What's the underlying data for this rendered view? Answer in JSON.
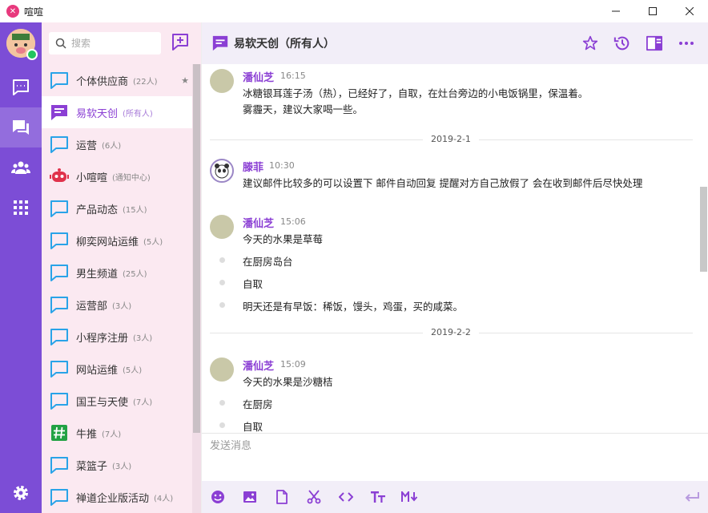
{
  "window": {
    "title": "喧喧",
    "minimize_icon": "minimize-icon",
    "maximize_icon": "maximize-icon",
    "close_icon": "close-icon"
  },
  "rail": {
    "user_status": "online",
    "items": [
      {
        "name": "chat-icon",
        "active": false
      },
      {
        "name": "discussion-icon",
        "active": true
      },
      {
        "name": "contacts-icon",
        "active": false
      },
      {
        "name": "apps-grid-icon",
        "active": false
      }
    ],
    "settings_icon": "gear-icon"
  },
  "sidebar": {
    "search_placeholder": "搜索",
    "new_chat_icon": "new-chat-icon",
    "items": [
      {
        "name": "个体供应商",
        "count": "(22人)",
        "starred": true,
        "icon": "chat-bubble-icon",
        "active": false
      },
      {
        "name": "易软天创",
        "count": "(所有人)",
        "starred": false,
        "icon": "system-chat-icon",
        "active": true
      },
      {
        "name": "运营",
        "count": "(6人)",
        "starred": false,
        "icon": "chat-bubble-icon",
        "active": false
      },
      {
        "name": "小喧喧",
        "count": "(通知中心)",
        "starred": false,
        "icon": "robot-icon",
        "active": false
      },
      {
        "name": "产品动态",
        "count": "(15人)",
        "starred": false,
        "icon": "chat-bubble-icon",
        "active": false
      },
      {
        "name": "柳奕网站运维",
        "count": "(5人)",
        "starred": false,
        "icon": "chat-bubble-icon",
        "active": false
      },
      {
        "name": "男生频道",
        "count": "(25人)",
        "starred": false,
        "icon": "chat-bubble-icon",
        "active": false
      },
      {
        "name": "运营部",
        "count": "(3人)",
        "starred": false,
        "icon": "chat-bubble-icon",
        "active": false
      },
      {
        "name": "小程序注册",
        "count": "(3人)",
        "starred": false,
        "icon": "chat-bubble-icon",
        "active": false
      },
      {
        "name": "网站运维",
        "count": "(5人)",
        "starred": false,
        "icon": "chat-bubble-icon",
        "active": false
      },
      {
        "name": "国王与天使",
        "count": "(7人)",
        "starred": false,
        "icon": "chat-bubble-icon",
        "active": false
      },
      {
        "name": "牛推",
        "count": "(7人)",
        "starred": false,
        "icon": "hashtag-icon",
        "active": false
      },
      {
        "name": "菜篮子",
        "count": "(3人)",
        "starred": false,
        "icon": "chat-bubble-icon",
        "active": false
      },
      {
        "name": "禅道企业版活动",
        "count": "(4人)",
        "starred": false,
        "icon": "chat-bubble-icon",
        "active": false
      }
    ]
  },
  "chat": {
    "title": "易软天创（所有人）",
    "header_icons": [
      "star-icon",
      "history-icon",
      "sidebar-toggle-icon",
      "more-icon"
    ],
    "messages": [
      {
        "author": "潘仙芝",
        "time": "16:15",
        "lines": [
          "冰糖银耳莲子汤（热），已经好了，自取，在灶台旁边的小电饭锅里，保温着。",
          "雾霾天，建议大家喝一些。"
        ]
      },
      {
        "separator": "2019-2-1"
      },
      {
        "author": "滕菲",
        "time": "10:30",
        "lines": [
          "建议邮件比较多的可以设置下 邮件自动回复 提醒对方自己放假了 会在收到邮件后尽快处理"
        ]
      },
      {
        "author": "潘仙芝",
        "time": "15:06",
        "lines": [
          "今天的水果是草莓"
        ],
        "bullets": [
          "在厨房岛台",
          "自取",
          "明天还是有早饭：稀饭，馒头，鸡蛋，买的咸菜。"
        ]
      },
      {
        "separator": "2019-2-2"
      },
      {
        "author": "潘仙芝",
        "time": "15:09",
        "lines": [
          "今天的水果是沙糖桔"
        ],
        "bullets": [
          "在厨房",
          "自取"
        ]
      }
    ],
    "composer_placeholder": "发送消息",
    "toolbar_icons": [
      "emoji-icon",
      "image-icon",
      "file-icon",
      "scissors-icon",
      "code-icon",
      "text-size-icon",
      "markdown-icon",
      "send-icon"
    ]
  },
  "colors": {
    "accent": "#7c4dd6",
    "author": "#8b3fd4",
    "sidebar_bg": "#fbe9f1",
    "header_bg": "#f2eef8"
  }
}
